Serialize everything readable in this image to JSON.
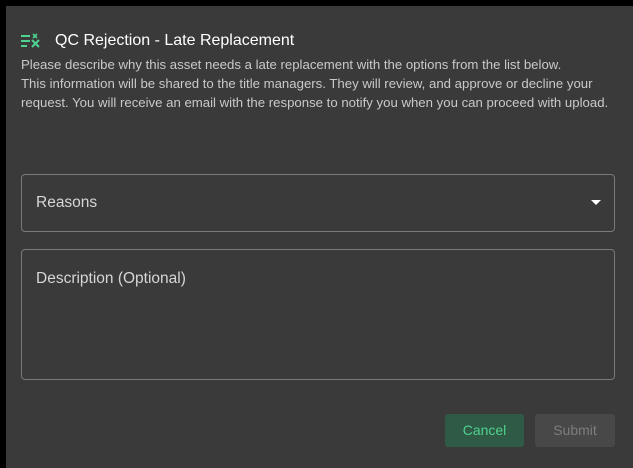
{
  "dialog": {
    "title": "QC Rejection - Late Replacement",
    "icon": "playlist-remove-icon",
    "description_lines": [
      "Please describe why this asset needs a late replacement with the options from the list below.",
      "This information will be shared to the title managers. They will review, and approve or decline your request. You will receive an email with the response to notify you when you can proceed with upload."
    ]
  },
  "form": {
    "reasons": {
      "label": "Reasons",
      "selected_value": ""
    },
    "description": {
      "placeholder": "Description (Optional)",
      "value": ""
    }
  },
  "actions": {
    "cancel_label": "Cancel",
    "submit_label": "Submit",
    "submit_disabled": true
  },
  "colors": {
    "dialog_background": "#3a3a3a",
    "accent_green": "#4fd28f",
    "cancel_background": "#2f5a45",
    "disabled_background": "#484848",
    "disabled_text": "#7d7d7d"
  }
}
